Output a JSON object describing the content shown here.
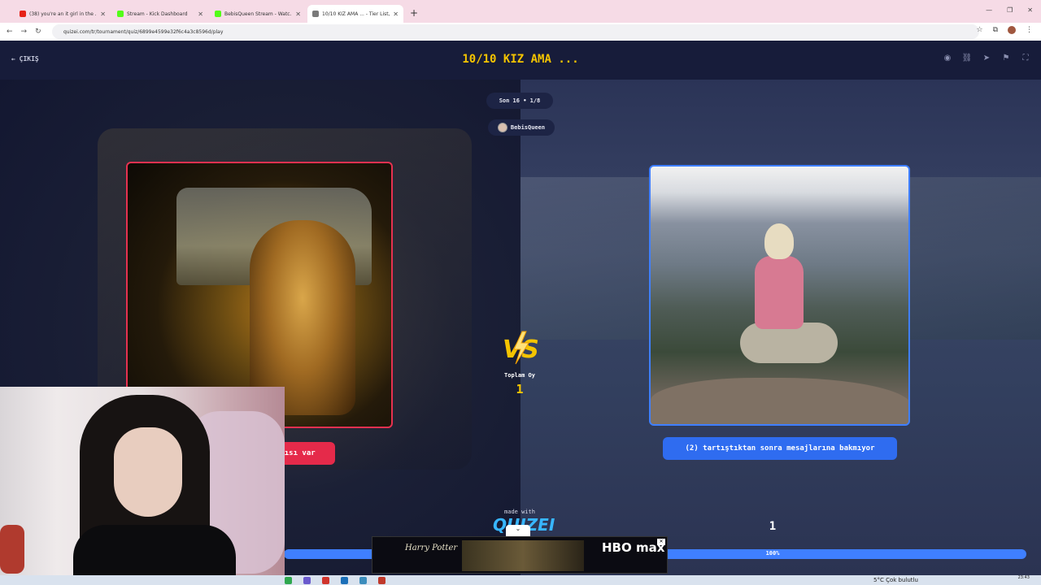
{
  "browser": {
    "tabs": [
      {
        "title": "(38) you're an it girl in the ...",
        "favicon_color": "#e62117",
        "active": false
      },
      {
        "title": "Stream - Kick Dashboard",
        "favicon_color": "#53fc18",
        "active": false
      },
      {
        "title": "BebisQueen Stream - Watc...",
        "favicon_color": "#53fc18",
        "active": false
      },
      {
        "title": "10/10 KIZ AMA ... - Tier List, Ki...",
        "favicon_color": "#7a7a7a",
        "active": true
      }
    ],
    "url": "quizei.com/tr/tournament/quiz/6899e4599e32f6c4a3c8596d/play"
  },
  "header": {
    "exit_label": "ÇIKIŞ",
    "title": "10/10 KIZ AMA ..."
  },
  "round": {
    "label": "Son 16 • 1/8",
    "user": "BebisQueen"
  },
  "left": {
    "caption": "tısı var",
    "border_color": "#e63150"
  },
  "right": {
    "caption": "(2) tartıştıktan sonra mesajlarına bakmıyor",
    "votes": "1",
    "progress_label": "100%",
    "progress": 1.0,
    "border_color": "#3f7fff"
  },
  "center": {
    "vs": "VS",
    "total_label": "Toplam Oy",
    "total_value": "1"
  },
  "footer": {
    "made_with": "made with",
    "logo": "QUIZEI"
  },
  "ad": {
    "left_text": "Harry Potter",
    "right_text": "HBO max"
  },
  "taskbar": {
    "weather": "5°C  Çok bulutlu",
    "time": "23:43"
  },
  "colors": {
    "accent_yellow": "#f4c400",
    "accent_red": "#e52a4a",
    "accent_blue": "#2f6cf0",
    "page_bg": "#151a36"
  }
}
